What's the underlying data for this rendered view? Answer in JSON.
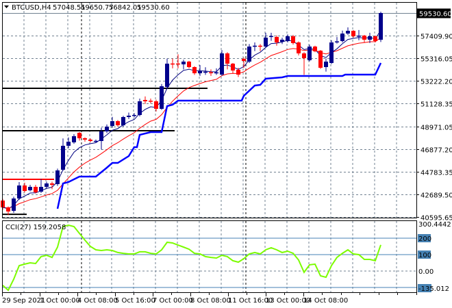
{
  "header": {
    "symbol": "BTCUSD,H4",
    "open": "57048.51",
    "high": "59650.77",
    "low": "56842.01",
    "close": "59530.60",
    "menu_icon": "triangle-down-icon"
  },
  "colors": {
    "bull": "#00008B",
    "bear": "#FF0000",
    "fast_ma": "#000080",
    "slow_ma": "#FF0000",
    "trail": "#0000FF",
    "cci": "#7CFC00",
    "cci_levels": "#4682B4",
    "grid": "#708090"
  },
  "chart_data": {
    "type": "candlestick",
    "title": "BTCUSD,H4",
    "current_price_label": "59530.60",
    "price_axis_labels": [
      "57409.90",
      "55316.05",
      "53222.20",
      "51128.35",
      "48971.05",
      "46877.20",
      "44783.35",
      "42689.50",
      "40595.65"
    ],
    "price_axis_values": [
      57409.9,
      55316.05,
      53222.2,
      51128.35,
      48971.05,
      46877.2,
      44783.35,
      42689.5,
      40595.65
    ],
    "time_labels": [
      "29 Sep 2021",
      "1 Oct 00:00",
      "4 Oct 08:00",
      "5 Oct 16:00",
      "7 Oct 00:00",
      "8 Oct 08:00",
      "11 Oct 16:00",
      "13 Oct 00:00",
      "14 Oct 08:00"
    ],
    "time_label_candle_index": [
      0,
      7,
      14,
      21,
      28,
      35,
      42,
      49,
      56
    ],
    "ohlc": [
      [
        42145,
        42300,
        41300,
        41510
      ],
      [
        41510,
        41600,
        40800,
        41130
      ],
      [
        41190,
        42500,
        41000,
        42335
      ],
      [
        42335,
        43860,
        42200,
        43541
      ],
      [
        43541,
        43800,
        42900,
        43033
      ],
      [
        43100,
        43600,
        43000,
        43414
      ],
      [
        43414,
        43600,
        42800,
        42906
      ],
      [
        42970,
        44150,
        42850,
        43414
      ],
      [
        43414,
        43900,
        43300,
        43731
      ],
      [
        43731,
        43900,
        43200,
        43604
      ],
      [
        43668,
        45100,
        43500,
        44937
      ],
      [
        45000,
        47900,
        44900,
        47221
      ],
      [
        47221,
        48000,
        47000,
        47601
      ],
      [
        47538,
        48300,
        47400,
        48109
      ],
      [
        48427,
        48500,
        47700,
        47919
      ],
      [
        47919,
        48000,
        47600,
        47792
      ],
      [
        47792,
        47900,
        47550,
        47665
      ],
      [
        47640,
        47800,
        47500,
        47680
      ],
      [
        47665,
        48900,
        46870,
        48553
      ],
      [
        48553,
        49200,
        48400,
        48998
      ],
      [
        49061,
        49900,
        48900,
        49505
      ],
      [
        49505,
        49600,
        49000,
        49124
      ],
      [
        49124,
        50000,
        49000,
        49886
      ],
      [
        49886,
        50300,
        49700,
        50013
      ],
      [
        50013,
        50250,
        49850,
        50076
      ],
      [
        50076,
        51600,
        49950,
        51345
      ],
      [
        51472,
        51800,
        51100,
        51345
      ],
      [
        51400,
        51600,
        51150,
        51320
      ],
      [
        51345,
        51500,
        50400,
        50647
      ],
      [
        50647,
        52950,
        50550,
        52741
      ],
      [
        52677,
        55300,
        52550,
        54835
      ],
      [
        54850,
        55300,
        54400,
        54800
      ],
      [
        54850,
        55700,
        54400,
        54800
      ],
      [
        54771,
        55200,
        54300,
        55025
      ],
      [
        55025,
        55100,
        54400,
        54518
      ],
      [
        54518,
        54600,
        53800,
        53946
      ],
      [
        53946,
        54700,
        53700,
        54137
      ],
      [
        54050,
        54500,
        53800,
        54090
      ],
      [
        54040,
        54300,
        53700,
        53990
      ],
      [
        53990,
        54400,
        53800,
        54030
      ],
      [
        53819,
        56100,
        53700,
        55787
      ],
      [
        55787,
        55900,
        54300,
        54835
      ],
      [
        54835,
        54900,
        53950,
        54200
      ],
      [
        54264,
        54450,
        53600,
        53819
      ],
      [
        55279,
        55400,
        54450,
        55089
      ],
      [
        55025,
        56650,
        54900,
        56421
      ],
      [
        56460,
        56800,
        56000,
        56500
      ],
      [
        56500,
        56650,
        56000,
        56450
      ],
      [
        56421,
        57700,
        56300,
        57246
      ],
      [
        57340,
        57700,
        56950,
        57400
      ],
      [
        57309,
        57450,
        56500,
        56802
      ],
      [
        56865,
        57250,
        56650,
        57056
      ],
      [
        56929,
        57550,
        56800,
        57373
      ],
      [
        57373,
        57500,
        56600,
        56738
      ],
      [
        56802,
        56900,
        55600,
        55787
      ],
      [
        55787,
        55900,
        53800,
        55342
      ],
      [
        55152,
        56600,
        55050,
        56421
      ],
      [
        56421,
        56500,
        55900,
        55977
      ],
      [
        56041,
        56100,
        54350,
        54454
      ],
      [
        54518,
        55300,
        54100,
        55025
      ],
      [
        54898,
        57000,
        54800,
        56802
      ],
      [
        56840,
        57300,
        56700,
        56900
      ],
      [
        56929,
        57900,
        56800,
        57627
      ],
      [
        57627,
        58200,
        57500,
        57880
      ],
      [
        57880,
        57950,
        57250,
        57373
      ],
      [
        57373,
        57950,
        57000,
        57436
      ],
      [
        57436,
        57500,
        56800,
        57056
      ],
      [
        57056,
        57700,
        56750,
        57373
      ],
      [
        57373,
        57450,
        56800,
        56929
      ],
      [
        57048.51,
        59650.77,
        56842.01,
        59530.6
      ]
    ],
    "trailing_line": [
      [
        10,
        41383
      ],
      [
        11,
        43731
      ],
      [
        12,
        43858
      ],
      [
        14,
        44366
      ],
      [
        17,
        44366
      ],
      [
        19,
        45190
      ],
      [
        20,
        45634
      ],
      [
        21,
        45634
      ],
      [
        23,
        46269
      ],
      [
        24,
        47094
      ],
      [
        24.5,
        47094
      ],
      [
        25,
        48236
      ],
      [
        27,
        48490
      ],
      [
        29,
        48490
      ],
      [
        30,
        50901
      ],
      [
        31,
        51028
      ],
      [
        32,
        51409
      ],
      [
        43.6,
        51409
      ],
      [
        44,
        51853
      ],
      [
        46,
        52805
      ],
      [
        47,
        52868
      ],
      [
        48,
        53439
      ],
      [
        51,
        53566
      ],
      [
        52,
        53693
      ],
      [
        62,
        53693
      ],
      [
        62.5,
        53819
      ],
      [
        68,
        53819
      ],
      [
        69,
        54898
      ]
    ],
    "horizontal_lines": [
      {
        "price": 52550,
        "from": 0,
        "to": 37,
        "color": "#000000"
      },
      {
        "price": 48617,
        "from": 0,
        "to": 31,
        "color": "#000000"
      },
      {
        "price": 44112,
        "from": 0,
        "to": 9,
        "color": "#FF0000"
      },
      {
        "price": 40870,
        "from": 0,
        "to": 4,
        "color": "#000000"
      }
    ],
    "period_separators": [
      14,
      44
    ],
    "cci": {
      "label": "CCI(27) 159.2058",
      "axis_labels": [
        "300.4442",
        "200",
        "100",
        "0.00",
        "-135.012"
      ],
      "levels": [
        200,
        100,
        -100
      ],
      "range": [
        -135.012,
        300.4442
      ],
      "values": [
        -87,
        -117,
        -50,
        33,
        42,
        50,
        46,
        88,
        96,
        83,
        146,
        271,
        279,
        271,
        229,
        188,
        150,
        129,
        125,
        129,
        125,
        113,
        108,
        104,
        104,
        117,
        117,
        108,
        104,
        129,
        175,
        171,
        158,
        146,
        133,
        108,
        104,
        88,
        83,
        79,
        96,
        88,
        63,
        54,
        75,
        104,
        113,
        104,
        129,
        142,
        129,
        113,
        121,
        108,
        67,
        -8,
        38,
        42,
        -29,
        -38,
        33,
        83,
        108,
        129,
        104,
        100,
        71,
        71,
        63,
        159
      ]
    }
  }
}
